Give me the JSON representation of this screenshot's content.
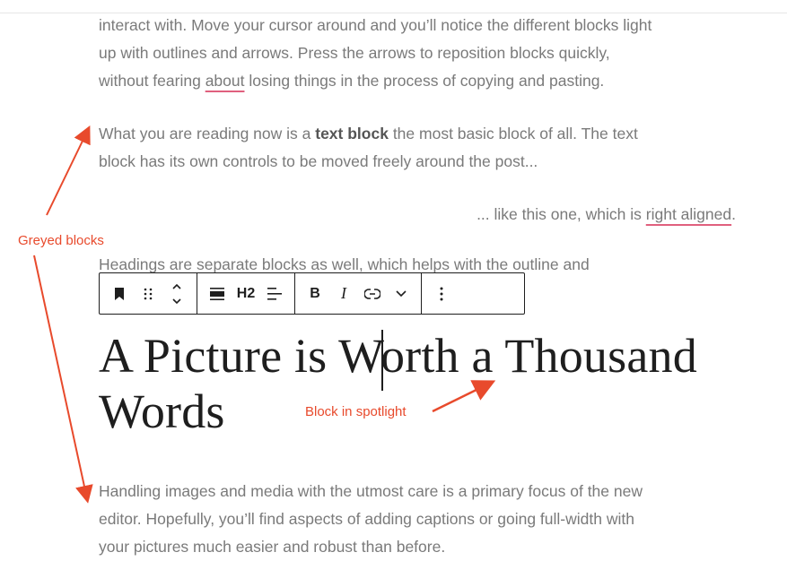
{
  "paragraphs": {
    "p1_line1": "interact with. Move your cursor around and you’ll notice the different blocks light",
    "p1_line2": "up with outlines and arrows. Press the arrows to reposition blocks quickly,",
    "p1_line3_pre": "without fearing ",
    "p1_line3_link": "about",
    "p1_line3_post": " losing things in the process of copying and pasting.",
    "p2_line1_pre": "What you are reading now is a ",
    "p2_line1_bold": "text block",
    "p2_line1_post": " the most basic block of all. The text",
    "p2_line2": "block has its own controls to be moved freely around the post...",
    "p3_pre": "... like this one, which is ",
    "p3_link": "right aligned",
    "p3_post": ".",
    "p4_line1": "Headings are separate blocks as well, which helps with the outline and",
    "p5_line1": "Handling images and media with the utmost care is a primary focus of the new",
    "p5_line2": "editor. Hopefully, you’ll find aspects of adding captions or going full-width with",
    "p5_line3": "your pictures much easier and robust than before."
  },
  "annotations": {
    "greyed": "Greyed blocks",
    "spotlight": "Block in spotlight",
    "color": "#e84a2c"
  },
  "toolbar": {
    "heading_level": "H2",
    "bold": "B",
    "italic": "I",
    "icons": [
      "bookmark-icon",
      "drag-handle-icon",
      "move-up-down-icon",
      "align-icon",
      "text-align-icon",
      "link-icon",
      "chevron-down-icon",
      "more-options-icon"
    ]
  },
  "heading": {
    "line1": "A Picture is Worth a Thousand",
    "line2": "Words"
  }
}
